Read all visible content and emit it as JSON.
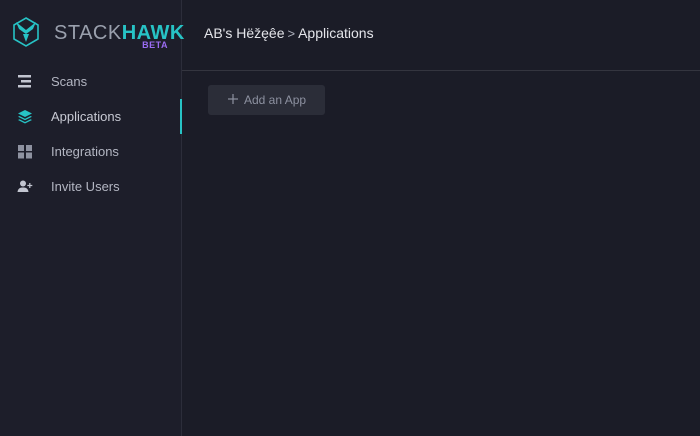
{
  "brand": {
    "name_part1": "STACK",
    "name_part2": "HAWK",
    "badge": "BETA",
    "accent": "#27c3c5",
    "badge_color": "#9a6cf2"
  },
  "sidebar": {
    "items": [
      {
        "label": "Scans",
        "icon": "scans-icon",
        "active": false
      },
      {
        "label": "Applications",
        "icon": "layers-icon",
        "active": true
      },
      {
        "label": "Integrations",
        "icon": "grid-icon",
        "active": false
      },
      {
        "label": "Invite Users",
        "icon": "add-user-icon",
        "active": false
      }
    ]
  },
  "header": {
    "org": "AB's Hëžęêe",
    "separator": ">",
    "page": "Applications"
  },
  "main": {
    "add_button_label": "Add an App",
    "add_button_icon": "plus-icon"
  }
}
